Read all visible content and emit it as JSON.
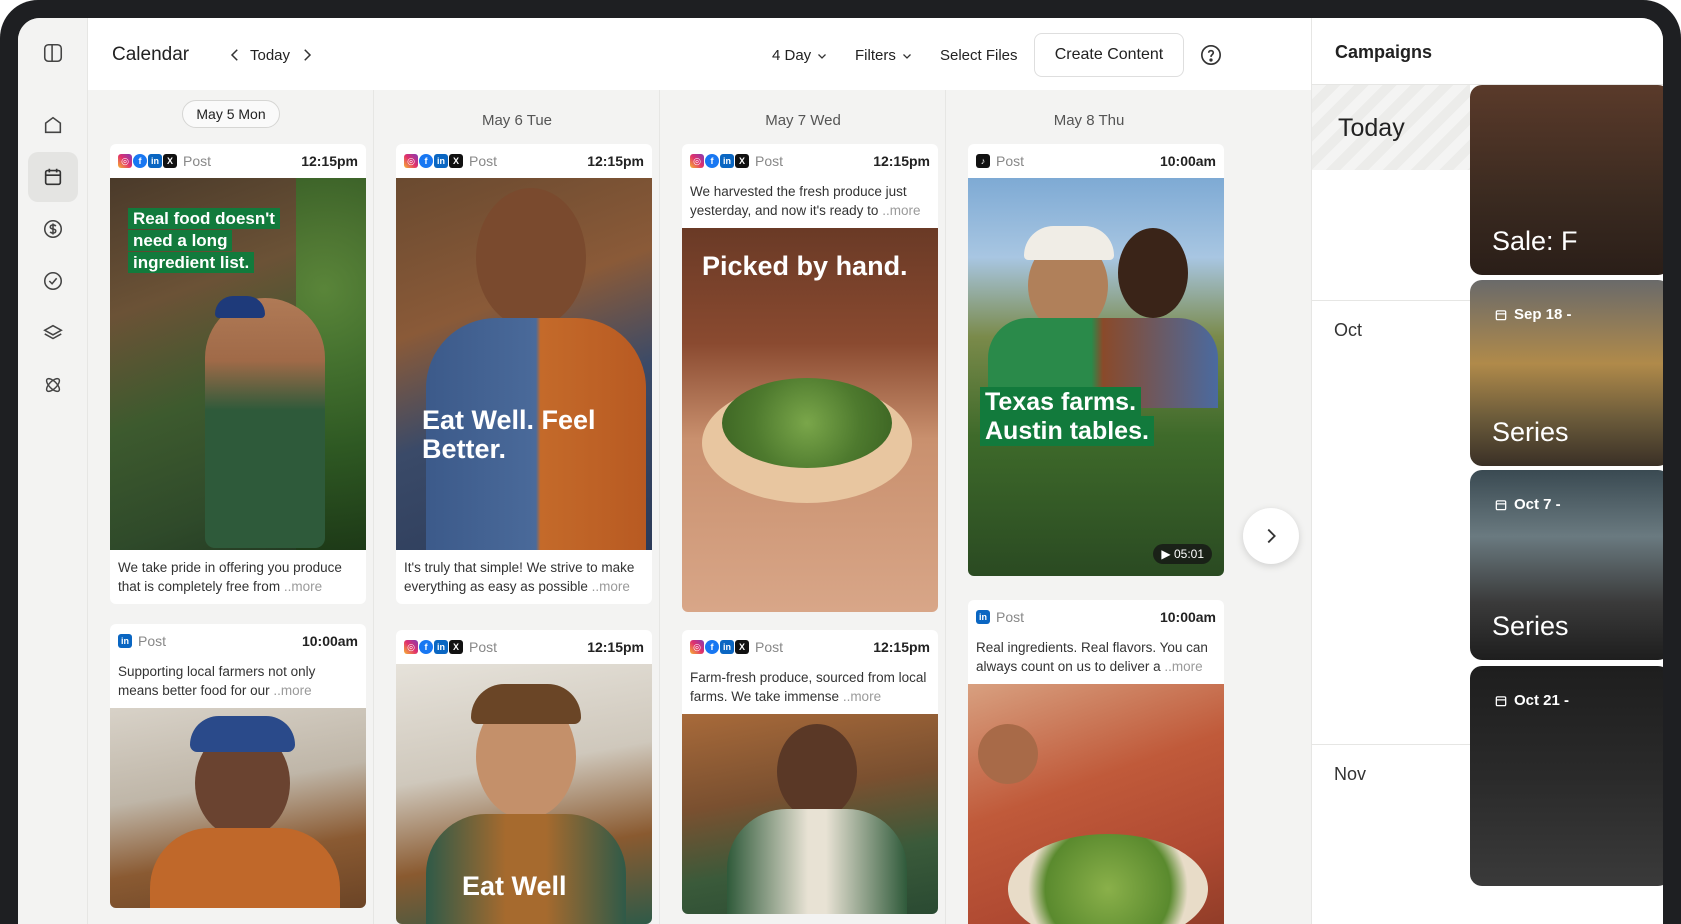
{
  "header": {
    "title": "Calendar",
    "today": "Today",
    "view": "4 Day",
    "filters": "Filters",
    "select_files": "Select Files",
    "create": "Create Content"
  },
  "days": [
    {
      "label": "May 5 Mon",
      "cards": [
        {
          "kind": "Post",
          "time": "12:15pm",
          "networks": [
            "instagram",
            "facebook",
            "linkedin",
            "x"
          ],
          "image_text": "Real food doesn't need a long ingredient list.",
          "text": "We take pride in offering you produce that is completely free from",
          "more": "..more"
        },
        {
          "kind": "Post",
          "time": "10:00am",
          "networks": [
            "linkedin"
          ],
          "text": "Supporting local farmers not only means better food for our",
          "more": "..more"
        }
      ]
    },
    {
      "label": "May 6 Tue",
      "cards": [
        {
          "kind": "Post",
          "time": "12:15pm",
          "networks": [
            "instagram",
            "facebook",
            "linkedin",
            "x"
          ],
          "image_text": "Eat Well. Feel Better.",
          "text": "It's truly that simple! We strive to make everything as easy as possible",
          "more": "..more"
        },
        {
          "kind": "Post",
          "time": "12:15pm",
          "networks": [
            "instagram",
            "facebook",
            "linkedin",
            "x"
          ],
          "image_text": "Eat Well"
        }
      ]
    },
    {
      "label": "May 7 Wed",
      "cards": [
        {
          "kind": "Post",
          "time": "12:15pm",
          "networks": [
            "instagram",
            "facebook",
            "linkedin",
            "x"
          ],
          "text": "We harvested the fresh produce just yesterday, and now it's ready to",
          "more": "..more",
          "image_text": "Picked by hand."
        },
        {
          "kind": "Post",
          "time": "12:15pm",
          "networks": [
            "instagram",
            "facebook",
            "linkedin",
            "x"
          ],
          "text": "Farm-fresh produce, sourced from local farms. We take immense",
          "more": "..more"
        }
      ]
    },
    {
      "label": "May 8 Thu",
      "cards": [
        {
          "kind": "Post",
          "time": "10:00am",
          "networks": [
            "tiktok"
          ],
          "image_text": "Texas farms. Austin tables.",
          "duration": "05:01"
        },
        {
          "kind": "Post",
          "time": "10:00am",
          "networks": [
            "linkedin"
          ],
          "text": "Real ingredients. Real flavors. You can always count on us to deliver a",
          "more": "..more"
        }
      ]
    }
  ],
  "campaigns": {
    "title": "Campaigns",
    "today": "Today",
    "months": [
      "Oct",
      "Nov"
    ],
    "cards": [
      {
        "name": "Sale: F"
      },
      {
        "date": "Sep 18 -",
        "name": "Series"
      },
      {
        "date": "Oct 7 -",
        "name": "Series"
      },
      {
        "date": "Oct 21 -"
      }
    ]
  },
  "icons": {
    "rail": [
      "sidebar-toggle-icon",
      "home-icon",
      "calendar-icon",
      "dollar-icon",
      "check-circle-icon",
      "layers-icon",
      "atom-icon"
    ],
    "header": [
      "chevron-left-icon",
      "chevron-right-icon",
      "chevron-down-icon",
      "help-icon"
    ]
  },
  "colors": {
    "accent_green": "#127a3c",
    "rail_bg": "#f3f3f2"
  }
}
